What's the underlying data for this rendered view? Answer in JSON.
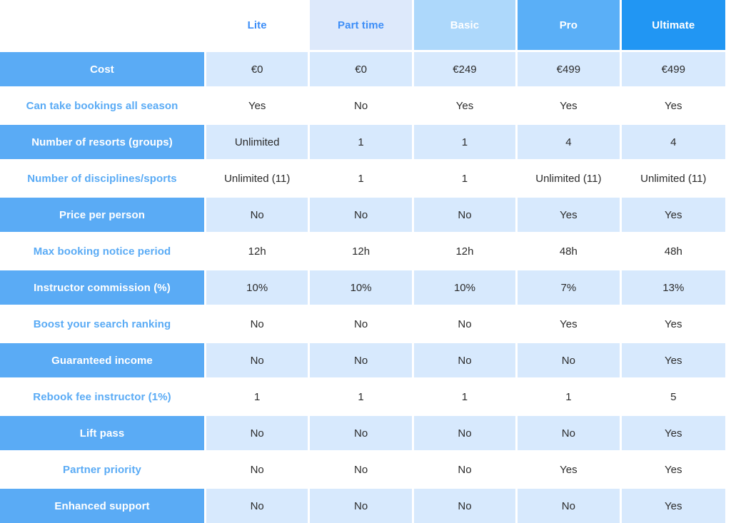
{
  "table": {
    "corner_label": "",
    "columns": [
      {
        "label": "Lite",
        "style": "plan-1"
      },
      {
        "label": "Part time",
        "style": "plan-2"
      },
      {
        "label": "Basic",
        "style": "plan-3"
      },
      {
        "label": "Pro",
        "style": "plan-4"
      },
      {
        "label": "Ultimate",
        "style": "plan-5"
      }
    ],
    "rows": [
      {
        "label": "Cost",
        "tinted": true,
        "values": [
          "€0",
          "€0",
          "€249",
          "€499",
          "€499"
        ]
      },
      {
        "label": "Can take bookings all season",
        "tinted": false,
        "values": [
          "Yes",
          "No",
          "Yes",
          "Yes",
          "Yes"
        ]
      },
      {
        "label": "Number of resorts (groups)",
        "tinted": true,
        "values": [
          "Unlimited",
          "1",
          "1",
          "4",
          "4"
        ]
      },
      {
        "label": "Number of disciplines/sports",
        "tinted": false,
        "values": [
          "Unlimited (11)",
          "1",
          "1",
          "Unlimited (11)",
          "Unlimited (11)"
        ]
      },
      {
        "label": "Price per person",
        "tinted": true,
        "values": [
          "No",
          "No",
          "No",
          "Yes",
          "Yes"
        ]
      },
      {
        "label": "Max booking notice period",
        "tinted": false,
        "values": [
          "12h",
          "12h",
          "12h",
          "48h",
          "48h"
        ]
      },
      {
        "label": "Instructor commission (%)",
        "tinted": true,
        "values": [
          "10%",
          "10%",
          "10%",
          "7%",
          "13%"
        ]
      },
      {
        "label": "Boost your search ranking",
        "tinted": false,
        "values": [
          "No",
          "No",
          "No",
          "Yes",
          "Yes"
        ]
      },
      {
        "label": "Guaranteed income",
        "tinted": true,
        "values": [
          "No",
          "No",
          "No",
          "No",
          "Yes"
        ]
      },
      {
        "label": "Rebook fee instructor (1%)",
        "tinted": false,
        "values": [
          "1",
          "1",
          "1",
          "1",
          "5"
        ]
      },
      {
        "label": "Lift pass",
        "tinted": true,
        "values": [
          "No",
          "No",
          "No",
          "No",
          "Yes"
        ]
      },
      {
        "label": "Partner priority",
        "tinted": false,
        "values": [
          "No",
          "No",
          "No",
          "Yes",
          "Yes"
        ]
      },
      {
        "label": "Enhanced support",
        "tinted": true,
        "values": [
          "No",
          "No",
          "No",
          "No",
          "Yes"
        ]
      }
    ]
  },
  "colors": {
    "accent_blue": "#5aabf5",
    "header_text_blue": "#3d8ef7",
    "header_lite": "#ffffff",
    "header_part_time": "#dde9fb",
    "header_basic": "#add8fb",
    "header_pro": "#5aaff7",
    "header_ultimate": "#2196f3",
    "cell_tint": "#d7e9fd",
    "cell_text": "#2b2b2b"
  },
  "chart_data": {
    "type": "table",
    "title": "Plan feature comparison",
    "categories": [
      "Lite",
      "Part time",
      "Basic",
      "Pro",
      "Ultimate"
    ],
    "row_labels": [
      "Cost",
      "Can take bookings all season",
      "Number of resorts (groups)",
      "Number of disciplines/sports",
      "Price per person",
      "Max booking notice period",
      "Instructor commission (%)",
      "Boost your search ranking",
      "Guaranteed income",
      "Rebook fee instructor (1%)",
      "Lift pass",
      "Partner priority",
      "Enhanced support"
    ],
    "cells": [
      [
        "€0",
        "€0",
        "€249",
        "€499",
        "€499"
      ],
      [
        "Yes",
        "No",
        "Yes",
        "Yes",
        "Yes"
      ],
      [
        "Unlimited",
        "1",
        "1",
        "4",
        "4"
      ],
      [
        "Unlimited (11)",
        "1",
        "1",
        "Unlimited (11)",
        "Unlimited (11)"
      ],
      [
        "No",
        "No",
        "No",
        "Yes",
        "Yes"
      ],
      [
        "12h",
        "12h",
        "12h",
        "48h",
        "48h"
      ],
      [
        "10%",
        "10%",
        "10%",
        "7%",
        "13%"
      ],
      [
        "No",
        "No",
        "No",
        "Yes",
        "Yes"
      ],
      [
        "No",
        "No",
        "No",
        "No",
        "Yes"
      ],
      [
        "1",
        "1",
        "1",
        "1",
        "5"
      ],
      [
        "No",
        "No",
        "No",
        "No",
        "Yes"
      ],
      [
        "No",
        "No",
        "No",
        "Yes",
        "Yes"
      ],
      [
        "No",
        "No",
        "No",
        "No",
        "Yes"
      ]
    ]
  }
}
